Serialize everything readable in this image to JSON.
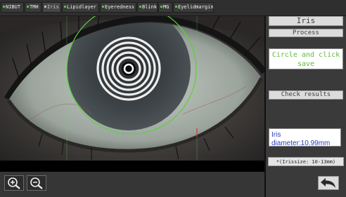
{
  "tabs": [
    {
      "label": "NIBUT",
      "active": false
    },
    {
      "label": "TMH",
      "active": false
    },
    {
      "label": "Iris",
      "active": true
    },
    {
      "label": "Lipidlayer",
      "active": false
    },
    {
      "label": "Eyeredness",
      "active": false
    },
    {
      "label": "Blink",
      "active": false
    },
    {
      "label": "MG",
      "active": false
    },
    {
      "label": "Eyelidmargin",
      "active": false
    }
  ],
  "panel": {
    "title": "Iris",
    "process_label": "Process",
    "instruction": "Circle and click save",
    "check_label": "Check results",
    "result_text": "Iris diameter:10.99mm",
    "range_text": "*(Irissize: 10-13mm)"
  },
  "colors": {
    "tab_indicator": "#55c04a",
    "measure_circle": "#58d23a",
    "instruction_text": "#5cbc3e",
    "result_text": "#2840b8"
  },
  "icons": {
    "zoom_in": "zoom-in-icon",
    "zoom_out": "zoom-out-icon",
    "back": "back-arrow-icon"
  }
}
